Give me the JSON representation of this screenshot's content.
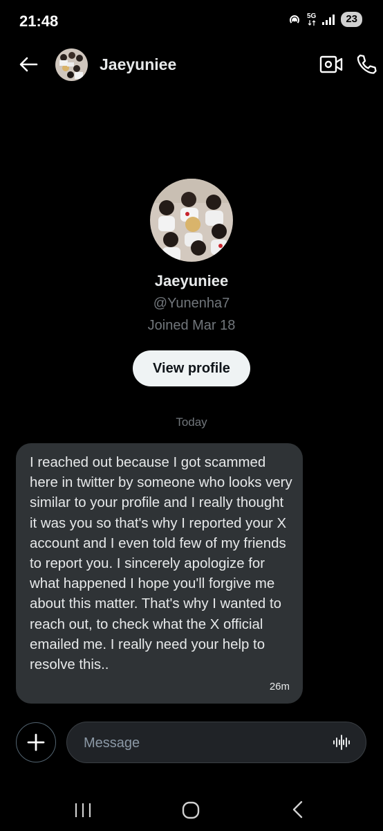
{
  "status_bar": {
    "time": "21:48",
    "network_label": "5G",
    "battery": "23",
    "icons": [
      "hotspot-icon",
      "network-5g-icon",
      "signal-icon",
      "battery-icon"
    ]
  },
  "header": {
    "title": "Jaeyuniee",
    "icons": [
      "back-arrow-icon",
      "avatar",
      "video-call-icon",
      "phone-icon"
    ]
  },
  "profile": {
    "name": "Jaeyuniee",
    "handle": "@Yunenha7",
    "joined": "Joined Mar 18",
    "view_profile_label": "View profile"
  },
  "conversation": {
    "date_separator": "Today",
    "messages": [
      {
        "text": "I reached out because I got scammed here in twitter by someone who looks very similar to your profile and I really thought it was you so that's why I reported your X account and I even told few of my friends to report you. I sincerely apologize for what happened I hope you'll forgive me about this matter. That's why I wanted to reach out, to check what the X official emailed me. I really need your help to resolve this..",
        "time": "26m"
      }
    ]
  },
  "composer": {
    "placeholder": "Message",
    "icons": [
      "plus-icon",
      "voice-waveform-icon"
    ]
  },
  "nav_bar": {
    "icons": [
      "recent-apps-icon",
      "home-icon",
      "back-icon"
    ]
  },
  "colors": {
    "background": "#000000",
    "bubble": "#2f3336",
    "secondary_text": "#71767b",
    "button_bg": "#eff3f4"
  }
}
